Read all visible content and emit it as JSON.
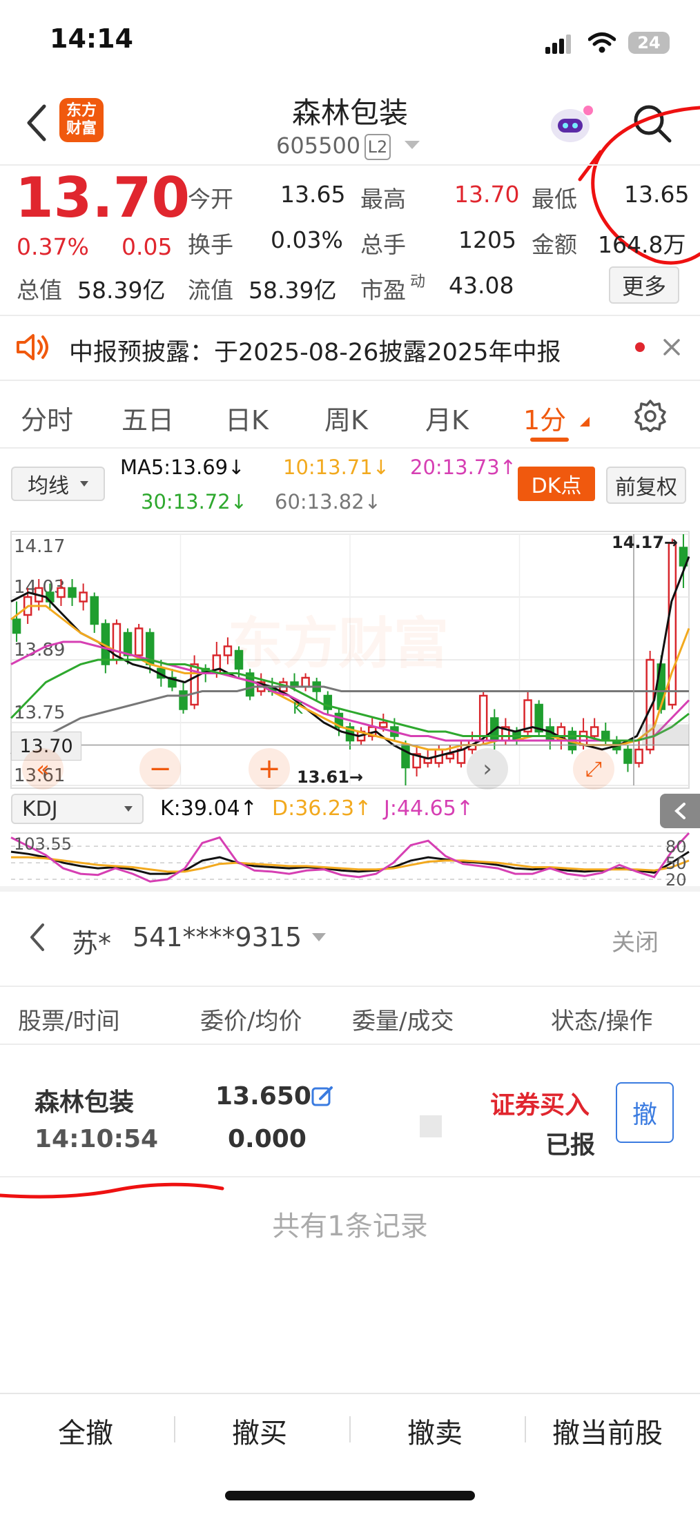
{
  "status_bar": {
    "time": "14:14",
    "battery": "24"
  },
  "header": {
    "logo_text": "东方\n财富",
    "stock_name": "森林包装",
    "stock_code": "605500",
    "level_badge": "L2"
  },
  "quote": {
    "price": "13.70",
    "change_pct": "0.37%",
    "change_amt": "0.05",
    "open_label": "今开",
    "open": "13.65",
    "high_label": "最高",
    "high": "13.70",
    "low_label": "最低",
    "low": "13.65",
    "turnover_label": "换手",
    "turnover": "0.03%",
    "volume_label": "总手",
    "volume": "1205",
    "amount_label": "金额",
    "amount": "164.8万",
    "mcap_label": "总值",
    "mcap": "58.39亿",
    "float_label": "流值",
    "float": "58.39亿",
    "pe_label": "市盈",
    "pe_sup": "动",
    "pe": "43.08",
    "more_label": "更多"
  },
  "notice": {
    "text": "中报预披露：于2025-08-26披露2025年中报"
  },
  "tabs": [
    {
      "label": "分时"
    },
    {
      "label": "五日"
    },
    {
      "label": "日K"
    },
    {
      "label": "周K"
    },
    {
      "label": "月K"
    },
    {
      "label": "1分"
    }
  ],
  "ma_bar": {
    "select": "均线",
    "ma5": "MA5:13.69↓",
    "ma10": "10:13.71↓",
    "ma20": "20:13.73↑",
    "ma30": "30:13.72↓",
    "ma60": "60:13.82↓",
    "dk_label": "DK点",
    "fq_label": "前复权"
  },
  "chart_data": {
    "type": "candlestick",
    "y_ticks": [
      "14.17",
      "14.03",
      "13.89",
      "13.75",
      "13.61"
    ],
    "ylim": [
      13.61,
      14.17
    ],
    "crosshair_value": "13.70",
    "high_annotation": "14.17→",
    "low_annotation": "13.61→",
    "k_marker": "K",
    "watermark": "东方财富",
    "candles": [
      [
        13.98,
        13.95,
        14.02,
        13.93
      ],
      [
        13.99,
        14.03,
        14.05,
        13.97
      ],
      [
        14.02,
        14.05,
        14.07,
        14.0
      ],
      [
        14.04,
        14.02,
        14.06,
        14.0
      ],
      [
        14.03,
        14.05,
        14.07,
        14.01
      ],
      [
        14.05,
        14.03,
        14.07,
        14.01
      ],
      [
        14.02,
        14.04,
        14.06,
        14.0
      ],
      [
        14.03,
        13.97,
        14.04,
        13.95
      ],
      [
        13.97,
        13.88,
        13.98,
        13.86
      ],
      [
        13.89,
        13.97,
        13.98,
        13.88
      ],
      [
        13.95,
        13.9,
        13.96,
        13.88
      ],
      [
        13.9,
        13.96,
        13.97,
        13.89
      ],
      [
        13.95,
        13.88,
        13.96,
        13.86
      ],
      [
        13.87,
        13.85,
        13.89,
        13.83
      ],
      [
        13.85,
        13.83,
        13.87,
        13.82
      ],
      [
        13.82,
        13.78,
        13.84,
        13.77
      ],
      [
        13.79,
        13.88,
        13.9,
        13.78
      ],
      [
        13.87,
        13.86,
        13.88,
        13.84
      ],
      [
        13.86,
        13.9,
        13.93,
        13.85
      ],
      [
        13.9,
        13.92,
        13.94,
        13.88
      ],
      [
        13.91,
        13.87,
        13.92,
        13.85
      ],
      [
        13.86,
        13.81,
        13.87,
        13.8
      ],
      [
        13.82,
        13.84,
        13.86,
        13.81
      ],
      [
        13.83,
        13.82,
        13.85,
        13.81
      ],
      [
        13.82,
        13.84,
        13.85,
        13.81
      ],
      [
        13.84,
        13.83,
        13.86,
        13.82
      ],
      [
        13.83,
        13.85,
        13.86,
        13.82
      ],
      [
        13.84,
        13.82,
        13.85,
        13.8
      ],
      [
        13.81,
        13.78,
        13.82,
        13.77
      ],
      [
        13.77,
        13.74,
        13.78,
        13.72
      ],
      [
        13.74,
        13.71,
        13.75,
        13.69
      ],
      [
        13.71,
        13.73,
        13.74,
        13.7
      ],
      [
        13.72,
        13.74,
        13.76,
        13.71
      ],
      [
        13.74,
        13.75,
        13.77,
        13.73
      ],
      [
        13.74,
        13.72,
        13.76,
        13.71
      ],
      [
        13.7,
        13.65,
        13.71,
        13.61
      ],
      [
        13.65,
        13.68,
        13.7,
        13.63
      ],
      [
        13.66,
        13.67,
        13.69,
        13.65
      ],
      [
        13.66,
        13.69,
        13.7,
        13.65
      ],
      [
        13.67,
        13.68,
        13.7,
        13.66
      ],
      [
        13.66,
        13.69,
        13.71,
        13.65
      ],
      [
        13.69,
        13.71,
        13.73,
        13.68
      ],
      [
        13.71,
        13.81,
        13.82,
        13.7
      ],
      [
        13.76,
        13.71,
        13.78,
        13.69
      ],
      [
        13.71,
        13.74,
        13.76,
        13.7
      ],
      [
        13.73,
        13.71,
        13.74,
        13.7
      ],
      [
        13.73,
        13.8,
        13.82,
        13.72
      ],
      [
        13.79,
        13.73,
        13.8,
        13.72
      ],
      [
        13.74,
        13.71,
        13.76,
        13.69
      ],
      [
        13.71,
        13.74,
        13.75,
        13.69
      ],
      [
        13.73,
        13.69,
        13.74,
        13.68
      ],
      [
        13.7,
        13.73,
        13.76,
        13.69
      ],
      [
        13.72,
        13.74,
        13.76,
        13.71
      ],
      [
        13.73,
        13.71,
        13.75,
        13.7
      ],
      [
        13.71,
        13.69,
        13.72,
        13.68
      ],
      [
        13.69,
        13.66,
        13.7,
        13.64
      ],
      [
        13.66,
        13.69,
        13.71,
        13.65
      ],
      [
        13.69,
        13.89,
        13.91,
        13.68
      ],
      [
        13.88,
        13.78,
        13.9,
        13.77
      ],
      [
        13.79,
        14.15,
        14.16,
        13.78
      ],
      [
        14.14,
        14.1,
        14.17,
        14.05
      ]
    ],
    "series": [
      {
        "name": "MA5",
        "color": "#111111",
        "values": [
          14.02,
          14.04,
          14.03,
          13.99,
          13.95,
          13.93,
          13.9,
          13.88,
          13.87,
          13.85,
          13.84,
          13.86,
          13.87,
          13.85,
          13.84,
          13.83,
          13.81,
          13.78,
          13.75,
          13.73,
          13.72,
          13.73,
          13.7,
          13.68,
          13.67,
          13.68,
          13.69,
          13.71,
          13.74,
          13.73,
          13.74,
          13.73,
          13.71,
          13.7,
          13.69,
          13.7,
          13.72,
          13.8,
          14.02,
          14.12
        ]
      },
      {
        "name": "MA10",
        "color": "#f2a91e",
        "values": [
          13.98,
          14.01,
          14.01,
          13.98,
          13.95,
          13.93,
          13.91,
          13.9,
          13.88,
          13.87,
          13.86,
          13.86,
          13.86,
          13.85,
          13.84,
          13.82,
          13.8,
          13.78,
          13.76,
          13.74,
          13.73,
          13.72,
          13.71,
          13.7,
          13.69,
          13.69,
          13.7,
          13.7,
          13.71,
          13.71,
          13.72,
          13.72,
          13.71,
          13.7,
          13.7,
          13.7,
          13.71,
          13.74,
          13.86,
          13.96
        ]
      },
      {
        "name": "MA20",
        "color": "#d63fb3",
        "values": [
          13.88,
          13.9,
          13.92,
          13.93,
          13.93,
          13.92,
          13.91,
          13.9,
          13.89,
          13.88,
          13.87,
          13.86,
          13.86,
          13.85,
          13.84,
          13.82,
          13.81,
          13.79,
          13.77,
          13.76,
          13.75,
          13.74,
          13.73,
          13.72,
          13.72,
          13.71,
          13.71,
          13.71,
          13.71,
          13.71,
          13.71,
          13.71,
          13.71,
          13.71,
          13.71,
          13.71,
          13.71,
          13.72,
          13.76,
          13.8
        ]
      },
      {
        "name": "MA30",
        "color": "#2ea82e",
        "values": [
          13.76,
          13.8,
          13.84,
          13.86,
          13.88,
          13.89,
          13.89,
          13.89,
          13.89,
          13.88,
          13.88,
          13.87,
          13.86,
          13.86,
          13.85,
          13.84,
          13.83,
          13.81,
          13.79,
          13.78,
          13.77,
          13.76,
          13.75,
          13.74,
          13.73,
          13.73,
          13.72,
          13.72,
          13.72,
          13.72,
          13.72,
          13.72,
          13.72,
          13.72,
          13.71,
          13.71,
          13.71,
          13.72,
          13.74,
          13.77
        ]
      },
      {
        "name": "MA60",
        "color": "#777777",
        "values": [
          13.68,
          13.7,
          13.72,
          13.74,
          13.76,
          13.77,
          13.78,
          13.79,
          13.8,
          13.81,
          13.81,
          13.82,
          13.82,
          13.82,
          13.83,
          13.83,
          13.83,
          13.83,
          13.83,
          13.82,
          13.82,
          13.82,
          13.82,
          13.82,
          13.82,
          13.82,
          13.82,
          13.82,
          13.82,
          13.82,
          13.82,
          13.82,
          13.82,
          13.82,
          13.82,
          13.82,
          13.82,
          13.82,
          13.82,
          13.82
        ]
      }
    ]
  },
  "kdj": {
    "select": "KDJ",
    "k": "K:39.04↑",
    "d": "D:36.23↑",
    "j": "J:44.65↑",
    "top_value": "103.55",
    "scale_80": "80",
    "scale_50": "50",
    "scale_20": "20",
    "series": [
      {
        "name": "K",
        "color": "#111111",
        "values": [
          70,
          66,
          60,
          50,
          44,
          40,
          42,
          38,
          30,
          30,
          36,
          54,
          60,
          50,
          44,
          42,
          40,
          42,
          40,
          36,
          34,
          36,
          42,
          54,
          60,
          56,
          52,
          50,
          46,
          40,
          38,
          40,
          36,
          34,
          36,
          40,
          36,
          32,
          50,
          70
        ]
      },
      {
        "name": "D",
        "color": "#f2a91e",
        "values": [
          60,
          60,
          58,
          54,
          50,
          46,
          44,
          42,
          38,
          34,
          34,
          40,
          48,
          50,
          48,
          46,
          44,
          44,
          42,
          40,
          38,
          38,
          40,
          46,
          52,
          54,
          54,
          52,
          50,
          46,
          42,
          42,
          40,
          38,
          38,
          38,
          38,
          36,
          42,
          54
        ]
      },
      {
        "name": "J",
        "color": "#d63fb3",
        "values": [
          96,
          80,
          64,
          40,
          30,
          28,
          40,
          30,
          16,
          20,
          40,
          86,
          96,
          52,
          36,
          34,
          30,
          36,
          38,
          28,
          24,
          30,
          50,
          82,
          90,
          62,
          48,
          44,
          40,
          30,
          30,
          40,
          30,
          26,
          32,
          46,
          34,
          24,
          70,
          104
        ]
      }
    ]
  },
  "account": {
    "name": "苏*",
    "number": "541****9315",
    "close_label": "关闭"
  },
  "table": {
    "headers": [
      "股票/时间",
      "委价/均价",
      "委量/成交",
      "状态/操作"
    ],
    "rows": [
      {
        "stock": "森林包装",
        "time": "14:10:54",
        "order_price": "13.650",
        "avg_price": "0.000",
        "direction": "证券买入",
        "status": "已报",
        "cancel_label": "撤"
      }
    ],
    "summary": "共有1条记录"
  },
  "bottom_actions": [
    "全撤",
    "撤买",
    "撤卖",
    "撤当前股"
  ]
}
